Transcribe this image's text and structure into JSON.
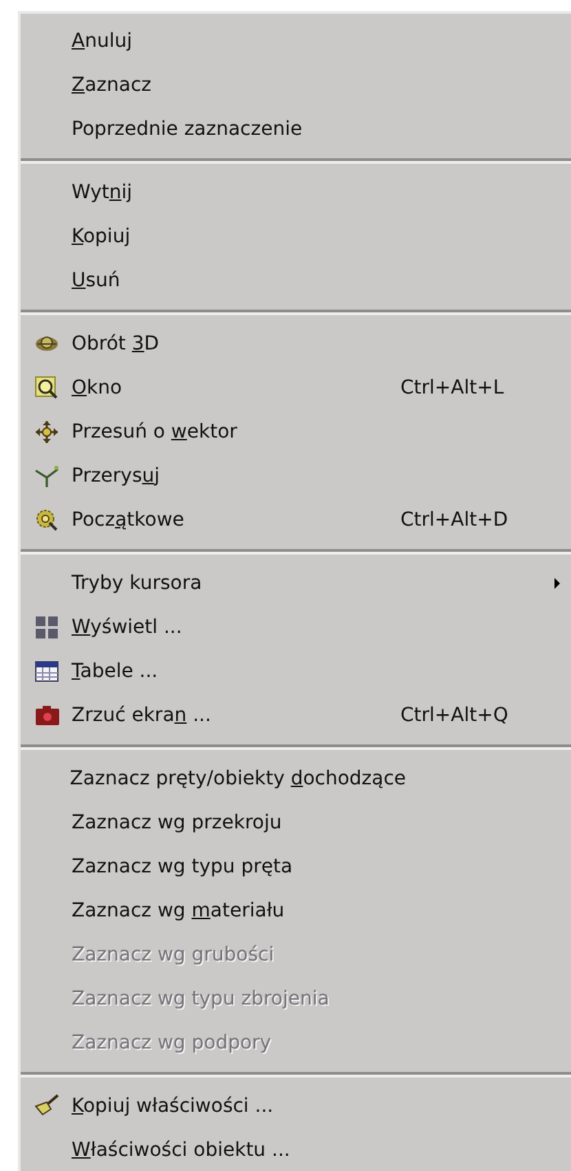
{
  "menu": {
    "entries": [
      {
        "kind": "item",
        "key": "A",
        "after": "nuluj",
        "disabled": false
      },
      {
        "kind": "item",
        "key": "Z",
        "after": "aznacz",
        "disabled": false
      },
      {
        "kind": "item",
        "before": "Poprzednie zaznaczenie",
        "disabled": false
      },
      {
        "kind": "separator"
      },
      {
        "kind": "item",
        "before": "Wyt",
        "key": "n",
        "after": "ij",
        "disabled": false
      },
      {
        "kind": "item",
        "key": "K",
        "after": "opiuj",
        "disabled": false
      },
      {
        "kind": "item",
        "key": "U",
        "after": "suń",
        "disabled": false
      },
      {
        "kind": "separator"
      },
      {
        "kind": "item",
        "before": "Obrót ",
        "key": "3",
        "after": "D",
        "disabled": false
      },
      {
        "kind": "item",
        "key": "O",
        "after": "kno",
        "shortcut": "Ctrl+Alt+L",
        "disabled": false
      },
      {
        "kind": "item",
        "before": "Przesuń o ",
        "key": "w",
        "after": "ektor",
        "disabled": false
      },
      {
        "kind": "item",
        "before": "Przerys",
        "key": "u",
        "after": "j",
        "disabled": false
      },
      {
        "kind": "item",
        "before": "Pocz",
        "key": "ą",
        "after": "tkowe",
        "shortcut": "Ctrl+Alt+D",
        "disabled": false
      },
      {
        "kind": "separator"
      },
      {
        "kind": "item",
        "before": "Tryby kursora",
        "submenu": true,
        "disabled": false
      },
      {
        "kind": "item",
        "key": "W",
        "after": "yświetl ...",
        "disabled": false
      },
      {
        "kind": "item",
        "key": "T",
        "after": "abele ...",
        "disabled": false
      },
      {
        "kind": "item",
        "before": "Zrzuć ekra",
        "key": "n",
        "after": " ...",
        "shortcut": "Ctrl+Alt+Q",
        "disabled": false
      },
      {
        "kind": "separator"
      },
      {
        "kind": "item",
        "before": "Zaznacz pręty/obiekty ",
        "key": "d",
        "after": "ochodzące",
        "disabled": false
      },
      {
        "kind": "item",
        "before": "Zaznacz wg przekroju",
        "disabled": false
      },
      {
        "kind": "item",
        "before": "Zaznacz wg typu pręta",
        "disabled": false
      },
      {
        "kind": "item",
        "before": "Zaznacz wg ",
        "key": "m",
        "after": "ateriału",
        "disabled": false
      },
      {
        "kind": "item",
        "before": "Zaznacz wg grubości",
        "disabled": true
      },
      {
        "kind": "item",
        "before": "Zaznacz wg typu zbrojenia",
        "disabled": true
      },
      {
        "kind": "item",
        "before": "Zaznacz wg podpory",
        "disabled": true
      },
      {
        "kind": "separator"
      },
      {
        "kind": "item",
        "key": "K",
        "after": "opiuj właściwości ...",
        "disabled": false
      },
      {
        "kind": "item",
        "key": "W",
        "after": "łaściwości obiektu ...",
        "disabled": false
      }
    ]
  }
}
